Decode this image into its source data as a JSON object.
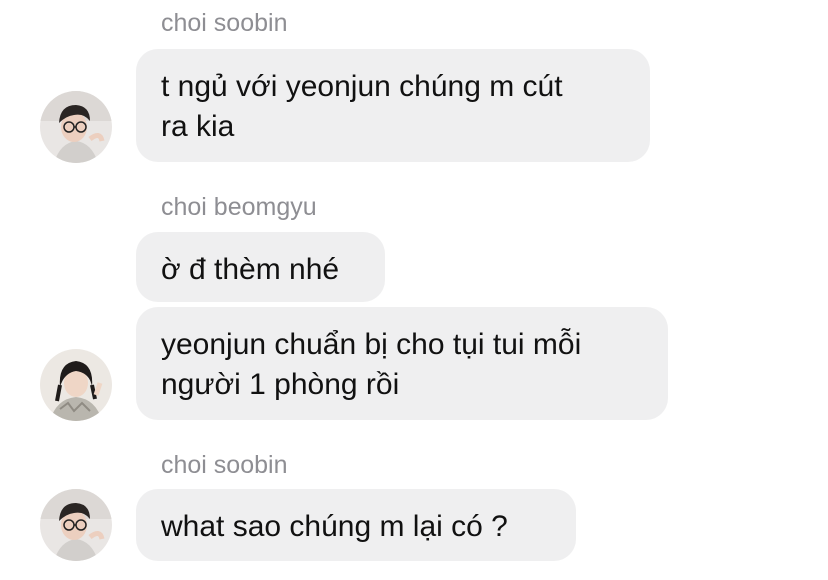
{
  "messages": [
    {
      "sender": "choi soobin",
      "bubbles": [
        "t ngủ với yeonjun chúng m cút\nra kia"
      ],
      "avatar_icon": "soobin-avatar-icon"
    },
    {
      "sender": "choi beomgyu",
      "bubbles": [
        "ờ đ thèm nhé",
        "yeonjun chuẩn bị cho tụi tui mỗi\nngười 1 phòng rồi"
      ],
      "avatar_icon": "beomgyu-avatar-icon"
    },
    {
      "sender": "choi soobin",
      "bubbles": [
        "what sao chúng m lại có ?"
      ],
      "avatar_icon": "soobin-avatar-icon"
    }
  ],
  "colors": {
    "bubble_bg": "#efeff0",
    "sender_text": "#8e8e93",
    "message_text": "#111111"
  }
}
